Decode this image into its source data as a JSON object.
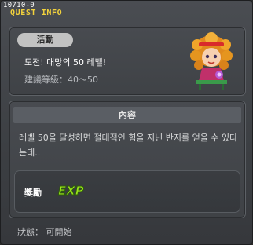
{
  "window": {
    "id_label": "10710-0",
    "title": "QUEST INFO"
  },
  "quest": {
    "category_badge": "活動",
    "title": "도전! 대망의 50 레벨!",
    "level_range": "建議等級：40～50"
  },
  "content": {
    "header": "內容",
    "description": "레벨 50을 달성하면 절대적인 힘을 지닌 반지를 얻을 수 있다는데..",
    "reward_label": "獎勵",
    "reward_icon": "exp-icon"
  },
  "status": {
    "text": "狀態： 可開始"
  },
  "colors": {
    "title": "#f2d23c",
    "exp": "#9be61e"
  }
}
